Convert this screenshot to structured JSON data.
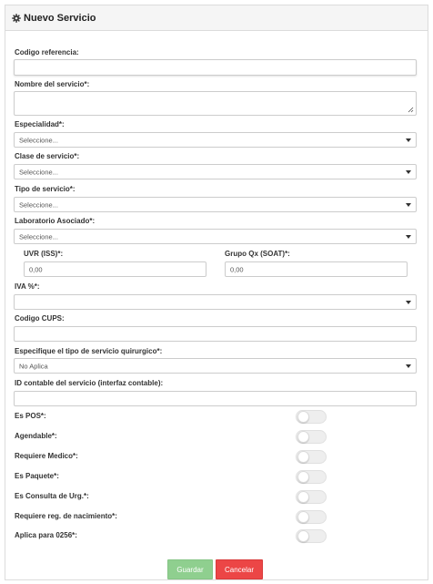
{
  "panel": {
    "title": "Nuevo Servicio",
    "icon": "gear-icon"
  },
  "form": {
    "codigo_referencia": {
      "label": "Codigo referencia:",
      "value": ""
    },
    "nombre_servicio": {
      "label": "Nombre del servicio*:",
      "value": ""
    },
    "especialidad": {
      "label": "Especialidad*:",
      "value": "Seleccione..."
    },
    "clase_servicio": {
      "label": "Clase de servicio*:",
      "value": "Seleccione..."
    },
    "tipo_servicio": {
      "label": "Tipo de servicio*:",
      "value": "Seleccione..."
    },
    "laboratorio": {
      "label": "Laboratorio Asociado*:",
      "value": "Seleccione..."
    },
    "uvr": {
      "label": "UVR (ISS)*:",
      "value": "0,00"
    },
    "grupo_qx": {
      "label": "Grupo Qx (SOAT)*:",
      "value": "0,00"
    },
    "iva": {
      "label": "IVA %*:",
      "value": ""
    },
    "codigo_cups": {
      "label": "Codigo CUPS:",
      "value": ""
    },
    "tipo_quirurgico": {
      "label": "Especifique el tipo de servicio quirurgico*:",
      "value": "No Aplica"
    },
    "id_contable": {
      "label": "ID contable del servicio (interfaz contable):",
      "value": ""
    }
  },
  "toggles": [
    {
      "label": "Es POS*:",
      "on": false
    },
    {
      "label": "Agendable*:",
      "on": false
    },
    {
      "label": "Requiere Medico*:",
      "on": false
    },
    {
      "label": "Es Paquete*:",
      "on": false
    },
    {
      "label": "Es Consulta de Urg.*:",
      "on": false
    },
    {
      "label": "Requiere reg. de nacimiento*:",
      "on": false
    },
    {
      "label": "Aplica para 0256*:",
      "on": false
    }
  ],
  "buttons": {
    "save": "Guardar",
    "cancel": "Cancelar"
  },
  "colors": {
    "save": "#8fcf8f",
    "cancel": "#ec4646",
    "header_bg": "#f5f5f5"
  }
}
